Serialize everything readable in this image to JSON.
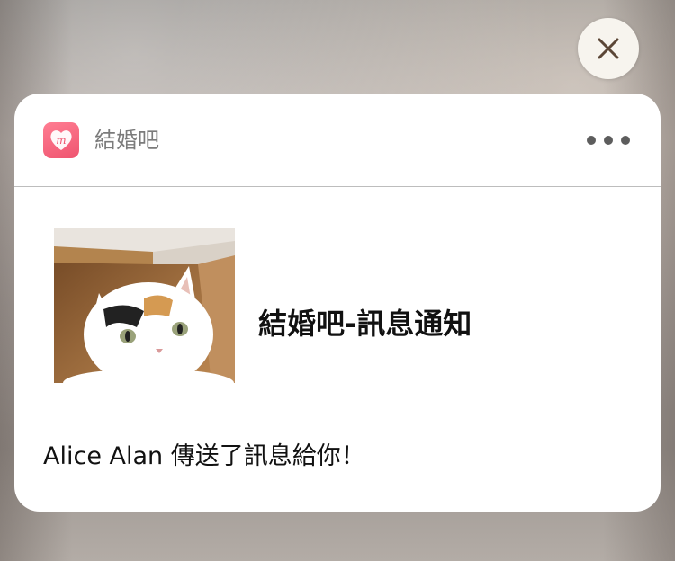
{
  "notification": {
    "app_name": "結婚吧",
    "app_icon": "app-logo-icon",
    "title": "結婚吧-訊息通知",
    "body": "Alice Alan 傳送了訊息給你！",
    "image": "cat-photo",
    "more_icon": "more-icon",
    "close_icon": "close-icon"
  },
  "colors": {
    "card_bg": "#ffffff",
    "app_icon_bg": "#ef5570",
    "app_name_text": "#7b7b7b",
    "close_button_bg": "#f7f4ee",
    "close_icon": "#5b4636"
  }
}
